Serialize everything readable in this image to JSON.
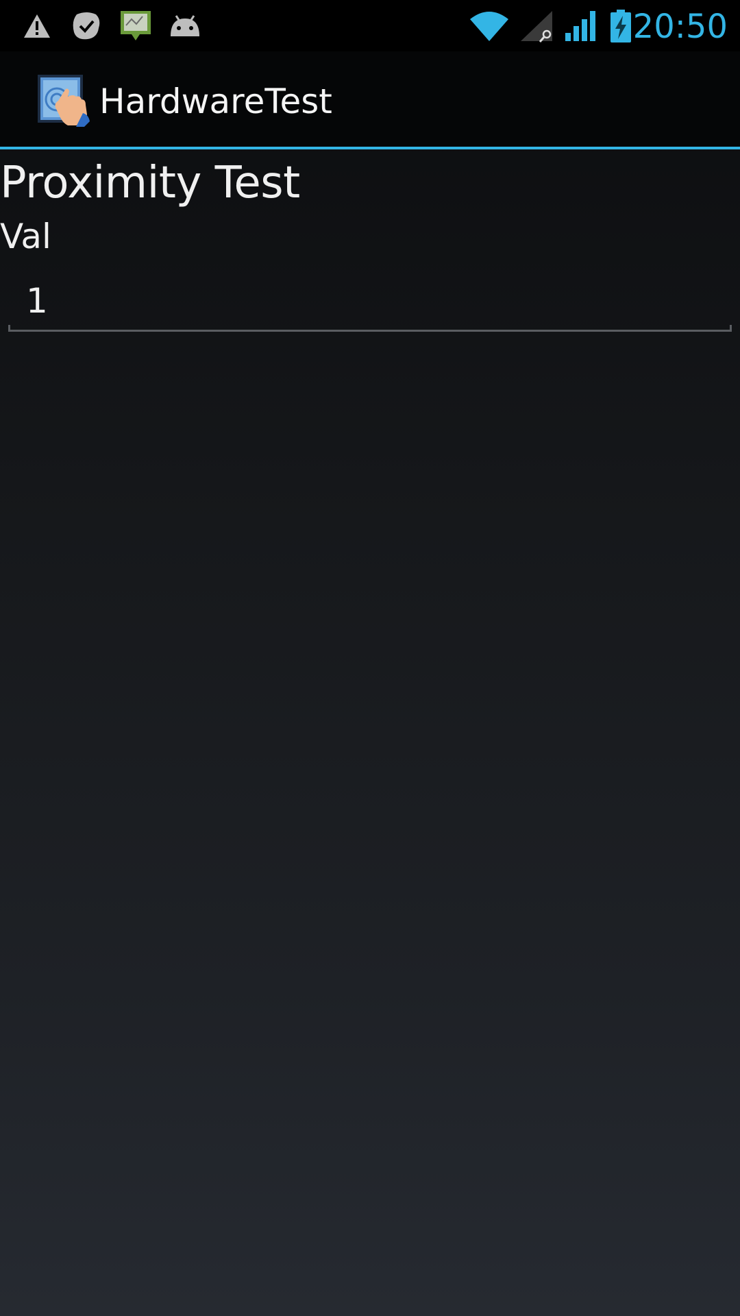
{
  "status_bar": {
    "time": "20:50",
    "notification_icons": [
      "warning-icon",
      "task-check-icon",
      "map-notification-icon",
      "android-debug-icon"
    ],
    "system_icons": [
      "wifi-icon",
      "signal-roaming-icon",
      "signal-icon",
      "battery-charging-icon"
    ],
    "accent_color": "#33b5e5"
  },
  "action_bar": {
    "app_title": "HardwareTest",
    "app_icon": "touch-screen-app-icon",
    "divider_color": "#33b5e5"
  },
  "content": {
    "title": "Proximity Test",
    "value_label": "Val",
    "value": "1"
  }
}
